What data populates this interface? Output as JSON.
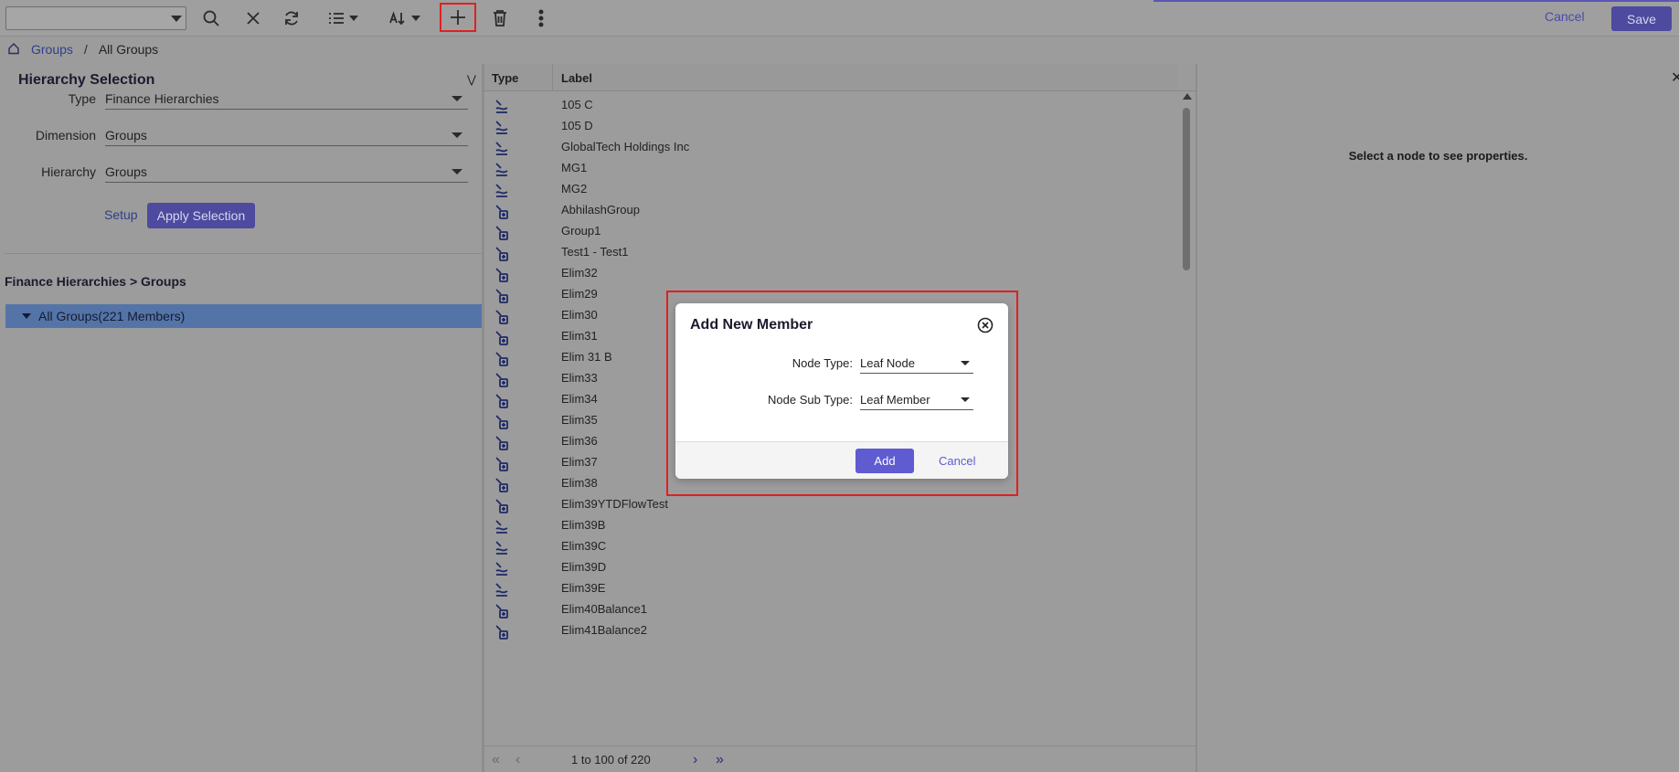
{
  "toolbar": {
    "cancel_label": "Cancel",
    "save_label": "Save",
    "icons": [
      "search-icon",
      "clear-icon",
      "refresh-icon",
      "list-view-icon",
      "sort-icon",
      "add-icon",
      "delete-icon",
      "more-icon"
    ]
  },
  "breadcrumb": {
    "link": "Groups",
    "separator": "/",
    "current": "All Groups"
  },
  "hierarchy_selection": {
    "title": "Hierarchy Selection",
    "fields": [
      {
        "label": "Type",
        "value": "Finance Hierarchies"
      },
      {
        "label": "Dimension",
        "value": "Groups"
      },
      {
        "label": "Hierarchy",
        "value": "Groups"
      }
    ],
    "setup_label": "Setup",
    "apply_label": "Apply Selection"
  },
  "tree": {
    "path_title": "Finance Hierarchies > Groups",
    "root_label": "All Groups(221 Members)"
  },
  "grid": {
    "col_type": "Type",
    "col_label": "Label",
    "rows": [
      {
        "label": "105 C",
        "icon": "aggregate-node-icon"
      },
      {
        "label": "105 D",
        "icon": "aggregate-node-icon"
      },
      {
        "label": "GlobalTech Holdings Inc",
        "icon": "aggregate-node-icon"
      },
      {
        "label": "MG1",
        "icon": "aggregate-node-icon"
      },
      {
        "label": "MG2",
        "icon": "aggregate-node-icon"
      },
      {
        "label": "AbhilashGroup",
        "icon": "leaf-node-icon"
      },
      {
        "label": "Group1",
        "icon": "leaf-node-icon"
      },
      {
        "label": "Test1 - Test1",
        "icon": "leaf-node-icon"
      },
      {
        "label": "Elim32",
        "icon": "leaf-node-icon"
      },
      {
        "label": "Elim29",
        "icon": "leaf-node-icon"
      },
      {
        "label": "Elim30",
        "icon": "leaf-node-icon"
      },
      {
        "label": "Elim31",
        "icon": "leaf-node-icon"
      },
      {
        "label": "Elim 31 B",
        "icon": "leaf-node-icon"
      },
      {
        "label": "Elim33",
        "icon": "leaf-node-icon"
      },
      {
        "label": "Elim34",
        "icon": "leaf-node-icon"
      },
      {
        "label": "Elim35",
        "icon": "leaf-node-icon"
      },
      {
        "label": "Elim36",
        "icon": "leaf-node-icon"
      },
      {
        "label": "Elim37",
        "icon": "leaf-node-icon"
      },
      {
        "label": "Elim38",
        "icon": "leaf-node-icon"
      },
      {
        "label": "Elim39YTDFlowTest",
        "icon": "leaf-node-icon"
      },
      {
        "label": "Elim39B",
        "icon": "aggregate-node-icon"
      },
      {
        "label": "Elim39C",
        "icon": "aggregate-node-icon"
      },
      {
        "label": "Elim39D",
        "icon": "aggregate-node-icon"
      },
      {
        "label": "Elim39E",
        "icon": "aggregate-node-icon"
      },
      {
        "label": "Elim40Balance1",
        "icon": "leaf-node-icon"
      },
      {
        "label": "Elim41Balance2",
        "icon": "leaf-node-icon"
      }
    ],
    "pager_text": "1 to 100 of 220"
  },
  "properties": {
    "message": "Select a node to see properties."
  },
  "modal": {
    "title": "Add New Member",
    "fields": [
      {
        "label": "Node Type:",
        "value": "Leaf Node"
      },
      {
        "label": "Node Sub Type:",
        "value": "Leaf Member"
      }
    ],
    "add_label": "Add",
    "cancel_label": "Cancel"
  },
  "colors": {
    "accent": "#5f5bd0",
    "highlight": "#e02020",
    "tree_selected": "#5474a8"
  }
}
